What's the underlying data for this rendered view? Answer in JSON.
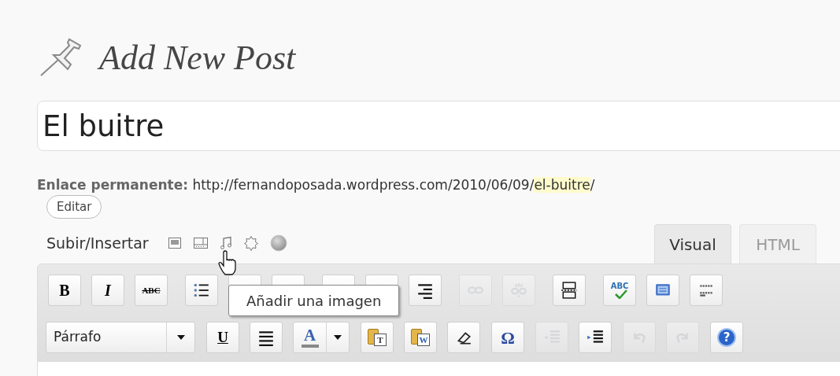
{
  "page_title": "Add New Post",
  "post_title": {
    "value": "El buitre"
  },
  "permalink": {
    "label": "Enlace permanente:",
    "url_base": "http://fernandoposada.wordpress.com/2010/06/09/",
    "slug": "el-buitre",
    "url_end": "/",
    "edit_button": "Editar"
  },
  "upload": {
    "label": "Subir/Insertar",
    "icons": [
      {
        "kind": "image"
      },
      {
        "kind": "video"
      },
      {
        "kind": "audio"
      },
      {
        "kind": "media"
      },
      {
        "kind": "poll"
      }
    ]
  },
  "tabs": [
    {
      "label": "Visual",
      "selected": true
    },
    {
      "label": "HTML",
      "selected": false
    }
  ],
  "toolbar_rows": [
    [
      [
        {
          "kind": "bold",
          "label": "B",
          "disabled": false
        },
        {
          "kind": "italic",
          "label": "I",
          "disabled": false
        },
        {
          "kind": "strike",
          "label": "ABC",
          "disabled": false
        }
      ],
      [
        {
          "kind": "bullets",
          "disabled": false
        },
        {
          "kind": "covered",
          "disabled": false
        },
        {
          "kind": "covered",
          "disabled": false
        }
      ],
      [
        {
          "kind": "covered",
          "disabled": false
        },
        {
          "kind": "covered",
          "disabled": false
        },
        {
          "kind": "align-right",
          "disabled": false
        }
      ],
      [
        {
          "kind": "link",
          "disabled": true
        },
        {
          "kind": "unlink",
          "disabled": true
        }
      ],
      [
        {
          "kind": "more",
          "disabled": false
        }
      ],
      [
        {
          "kind": "spell",
          "label": "ABC",
          "disabled": false
        },
        {
          "kind": "fullscreen",
          "disabled": false
        },
        {
          "kind": "kitchen-sink",
          "disabled": false
        }
      ]
    ],
    [
      [
        {
          "kind": "format",
          "label": "Párrafo",
          "disabled": false
        }
      ],
      [
        {
          "kind": "underline",
          "label": "U",
          "disabled": false
        },
        {
          "kind": "justify",
          "disabled": false
        },
        {
          "kind": "text-color",
          "label": "A",
          "disabled": false
        }
      ],
      [
        {
          "kind": "paste-text",
          "label": "T",
          "disabled": false
        },
        {
          "kind": "paste-word",
          "label": "W",
          "disabled": false
        },
        {
          "kind": "eraser",
          "disabled": false
        }
      ],
      [
        {
          "kind": "charmap",
          "label": "Ω",
          "disabled": false
        }
      ],
      [
        {
          "kind": "outdent",
          "disabled": true
        },
        {
          "kind": "indent",
          "disabled": false
        }
      ],
      [
        {
          "kind": "undo",
          "disabled": true
        },
        {
          "kind": "redo",
          "disabled": true
        }
      ],
      [
        {
          "kind": "help",
          "label": "?",
          "disabled": false
        }
      ]
    ]
  ],
  "tooltip": "Añadir una imagen"
}
